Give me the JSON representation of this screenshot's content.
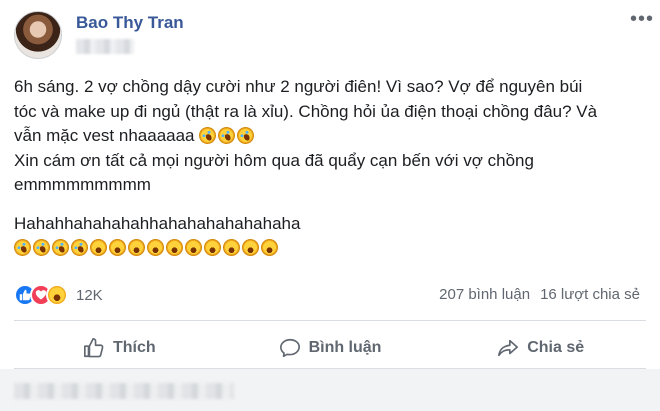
{
  "post": {
    "author": "Bao Thy Tran",
    "paragraphs": [
      "6h sáng. 2 vợ chồng dậy cười như 2 người điên! Vì sao? Vợ để nguyên búi",
      "tóc và make up đi ngủ (thật ra là xỉu). Chồng hỏi ủa điện thoại chồng đâu? Và",
      "vẫn mặc vest nhaaaaaa",
      "Xin cám ơn tất cả mọi người hôm qua đã quẩy cạn bến với vợ chồng",
      "emmmmmmmmm",
      "Hahahhahahahahhahahahahahahaha"
    ],
    "emoji_icons": [
      "rofl-emoji",
      "rofl-emoji",
      "rofl-emoji",
      "rofl-emoji",
      "laugh-emoji",
      "laugh-emoji",
      "laugh-emoji",
      "laugh-emoji",
      "laugh-emoji",
      "laugh-emoji",
      "laugh-emoji",
      "laugh-emoji",
      "laugh-emoji",
      "laugh-emoji"
    ],
    "inline_emoji_icons": [
      "rofl-emoji",
      "rofl-emoji",
      "rofl-emoji"
    ]
  },
  "reactions": {
    "icons": [
      "like-icon",
      "love-icon",
      "haha-icon"
    ],
    "count": "12K",
    "comments": "207 bình luận",
    "shares": "16 lượt chia sẻ"
  },
  "actions": {
    "like": "Thích",
    "comment": "Bình luận",
    "share": "Chia sẻ"
  },
  "colors": {
    "name": "#385898",
    "like": "#1877f2",
    "love": "#f33e58",
    "haha": "#ffd23b"
  }
}
